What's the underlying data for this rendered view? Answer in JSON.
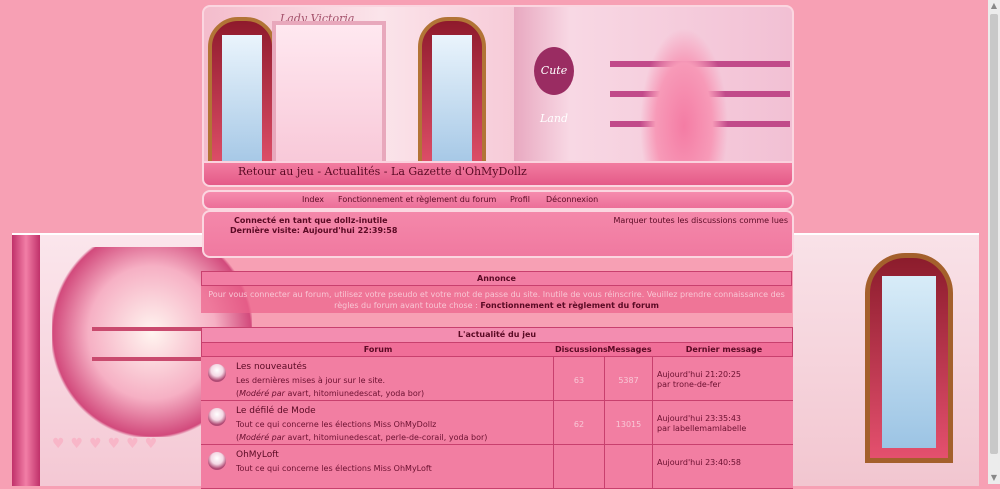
{
  "banner": {
    "sign": "Lady Victoria",
    "shop_sign": "Cute Land",
    "nav_link": "Retour au jeu - Actualités - La Gazette d'OhMyDollz"
  },
  "menu": {
    "items": [
      "Index",
      "Fonctionnement et règlement du forum",
      "Profil",
      "Déconnexion"
    ]
  },
  "user": {
    "connected": "Connecté en tant que dollz-inutile",
    "last_visit": "Dernière visite: Aujourd'hui 22:39:58",
    "mark_all": "Marquer toutes les discussions comme lues"
  },
  "annonce": {
    "title": "Annonce",
    "text": "Pour vous connecter au forum, utilisez votre pseudo et votre mot de passe du site. Inutile de vous réinscrire. Veuillez prendre connaissance des règles du forum avant toute chose :",
    "link": "Fonctionnement et règlement du forum"
  },
  "forum": {
    "category": "L'actualité du jeu",
    "columns": [
      "Forum",
      "Discussions",
      "Messages",
      "Dernier message"
    ],
    "rows": [
      {
        "title": "Les nouveautés",
        "desc": "Les dernières mises à jour sur le site.",
        "mod_label": "Modéré par",
        "mods": " avart, hitomiunedescat, yoda bor)",
        "discussions": "63",
        "messages": "5387",
        "last_date": "Aujourd'hui 21:20:25",
        "last_by": "par trone-de-fer"
      },
      {
        "title": "Le défilé de Mode",
        "desc": "Tout ce qui concerne les élections Miss OhMyDollz",
        "mod_label": "Modéré par",
        "mods": " avart, hitomiunedescat, perle-de-corail, yoda bor)",
        "discussions": "62",
        "messages": "13015",
        "last_date": "Aujourd'hui 23:35:43",
        "last_by": "par labellemamlabelle"
      },
      {
        "title": "OhMyLoft",
        "desc": "Tout ce qui concerne les élections Miss OhMyLoft",
        "mod_label": "",
        "mods": "",
        "discussions": "",
        "messages": "",
        "last_date": "Aujourd'hui 23:40:58",
        "last_by": ""
      }
    ]
  },
  "colors": {
    "page_bg": "#f7a0b4",
    "panel": "#f27ea2",
    "border": "#c8406e",
    "text": "#5a0a24"
  }
}
